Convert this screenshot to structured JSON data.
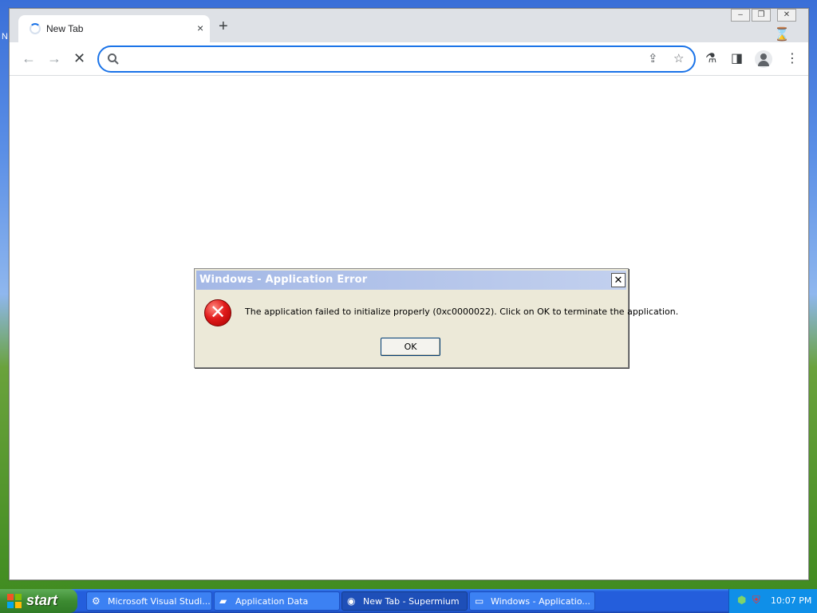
{
  "desktop": {
    "shortcut_label_fragment": "N"
  },
  "browser": {
    "tab": {
      "title": "New Tab",
      "close_glyph": "×"
    },
    "new_tab_glyph": "+",
    "window_controls": {
      "minimize": "–",
      "restore": "❐",
      "close": "✕"
    },
    "omnibox": {
      "value": "",
      "placeholder": ""
    }
  },
  "dialog": {
    "title": "Windows - Application Error",
    "close_glyph": "✕",
    "message": "The application failed to initialize properly (0xc0000022). Click on OK to terminate the application.",
    "ok_label": "OK",
    "icon": "error-icon"
  },
  "taskbar": {
    "start_label": "start",
    "items": [
      {
        "label": "Microsoft Visual Studi...",
        "icon": "visual-studio-icon",
        "active": false
      },
      {
        "label": "Application Data",
        "icon": "folder-icon",
        "active": false
      },
      {
        "label": "New Tab - Supermium",
        "icon": "browser-icon",
        "active": true
      },
      {
        "label": "Windows - Applicatio...",
        "icon": "window-icon",
        "active": false
      }
    ],
    "clock": "10:07 PM"
  },
  "colors": {
    "omnibox_border": "#1a73e8",
    "taskbar_blue": "#245edc",
    "start_green": "#3c8b31",
    "dialog_bg": "#ece9d8",
    "error_red": "#e11b1b"
  }
}
